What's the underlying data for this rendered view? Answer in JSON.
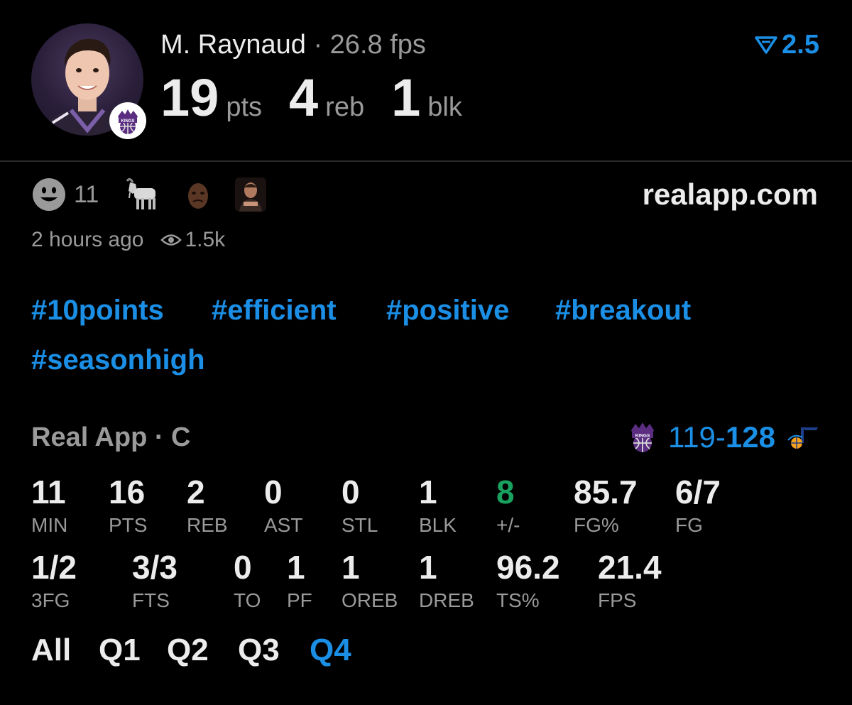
{
  "player": {
    "name": "M. Raynaud",
    "separator": "·",
    "fps": "26.8 fps",
    "team_logo": "sacramento-kings-logo"
  },
  "headline_stats": [
    {
      "value": "19",
      "unit": "pts"
    },
    {
      "value": "4",
      "unit": "reb"
    },
    {
      "value": "1",
      "unit": "blk"
    }
  ],
  "boost": {
    "icon": "boost-triangle-icon",
    "value": "2.5"
  },
  "reactions": {
    "smiley_count": "11",
    "icons": [
      "smiley-icon",
      "goat-emoji",
      "crying-jordan-reaction",
      "player-reaction-image"
    ]
  },
  "site": "realapp.com",
  "meta": {
    "time_ago": "2 hours ago",
    "views": "1.5k"
  },
  "hashtags": [
    "#10points",
    "#efficient",
    "#positive",
    "#breakout",
    "#seasonhigh"
  ],
  "game": {
    "source": "Real App · C",
    "score_home": "119",
    "score_dash": "-",
    "score_away": "128",
    "home_logo": "sacramento-kings-logo",
    "away_logo": "utah-jazz-logo"
  },
  "stats_row1": [
    {
      "value": "11",
      "label": "MIN"
    },
    {
      "value": "16",
      "label": "PTS"
    },
    {
      "value": "2",
      "label": "REB"
    },
    {
      "value": "0",
      "label": "AST"
    },
    {
      "value": "0",
      "label": "STL"
    },
    {
      "value": "1",
      "label": "BLK"
    },
    {
      "value": "8",
      "label": "+/-"
    },
    {
      "value": "85.7",
      "label": "FG%"
    },
    {
      "value": "6/7",
      "label": "FG"
    }
  ],
  "stats_row2": [
    {
      "value": "1/2",
      "label": "3FG"
    },
    {
      "value": "3/3",
      "label": "FTS"
    },
    {
      "value": "0",
      "label": "TO"
    },
    {
      "value": "1",
      "label": "PF"
    },
    {
      "value": "1",
      "label": "OREB"
    },
    {
      "value": "1",
      "label": "DREB"
    },
    {
      "value": "96.2",
      "label": "TS%"
    },
    {
      "value": "21.4",
      "label": "FPS"
    }
  ],
  "quarter_tabs": [
    "All",
    "Q1",
    "Q2",
    "Q3",
    "Q4"
  ],
  "active_tab": "Q4",
  "colors": {
    "accent_blue": "#1b8fe6",
    "positive_green": "#19a15f",
    "muted_gray": "#9a9a9a",
    "background": "#000000"
  }
}
